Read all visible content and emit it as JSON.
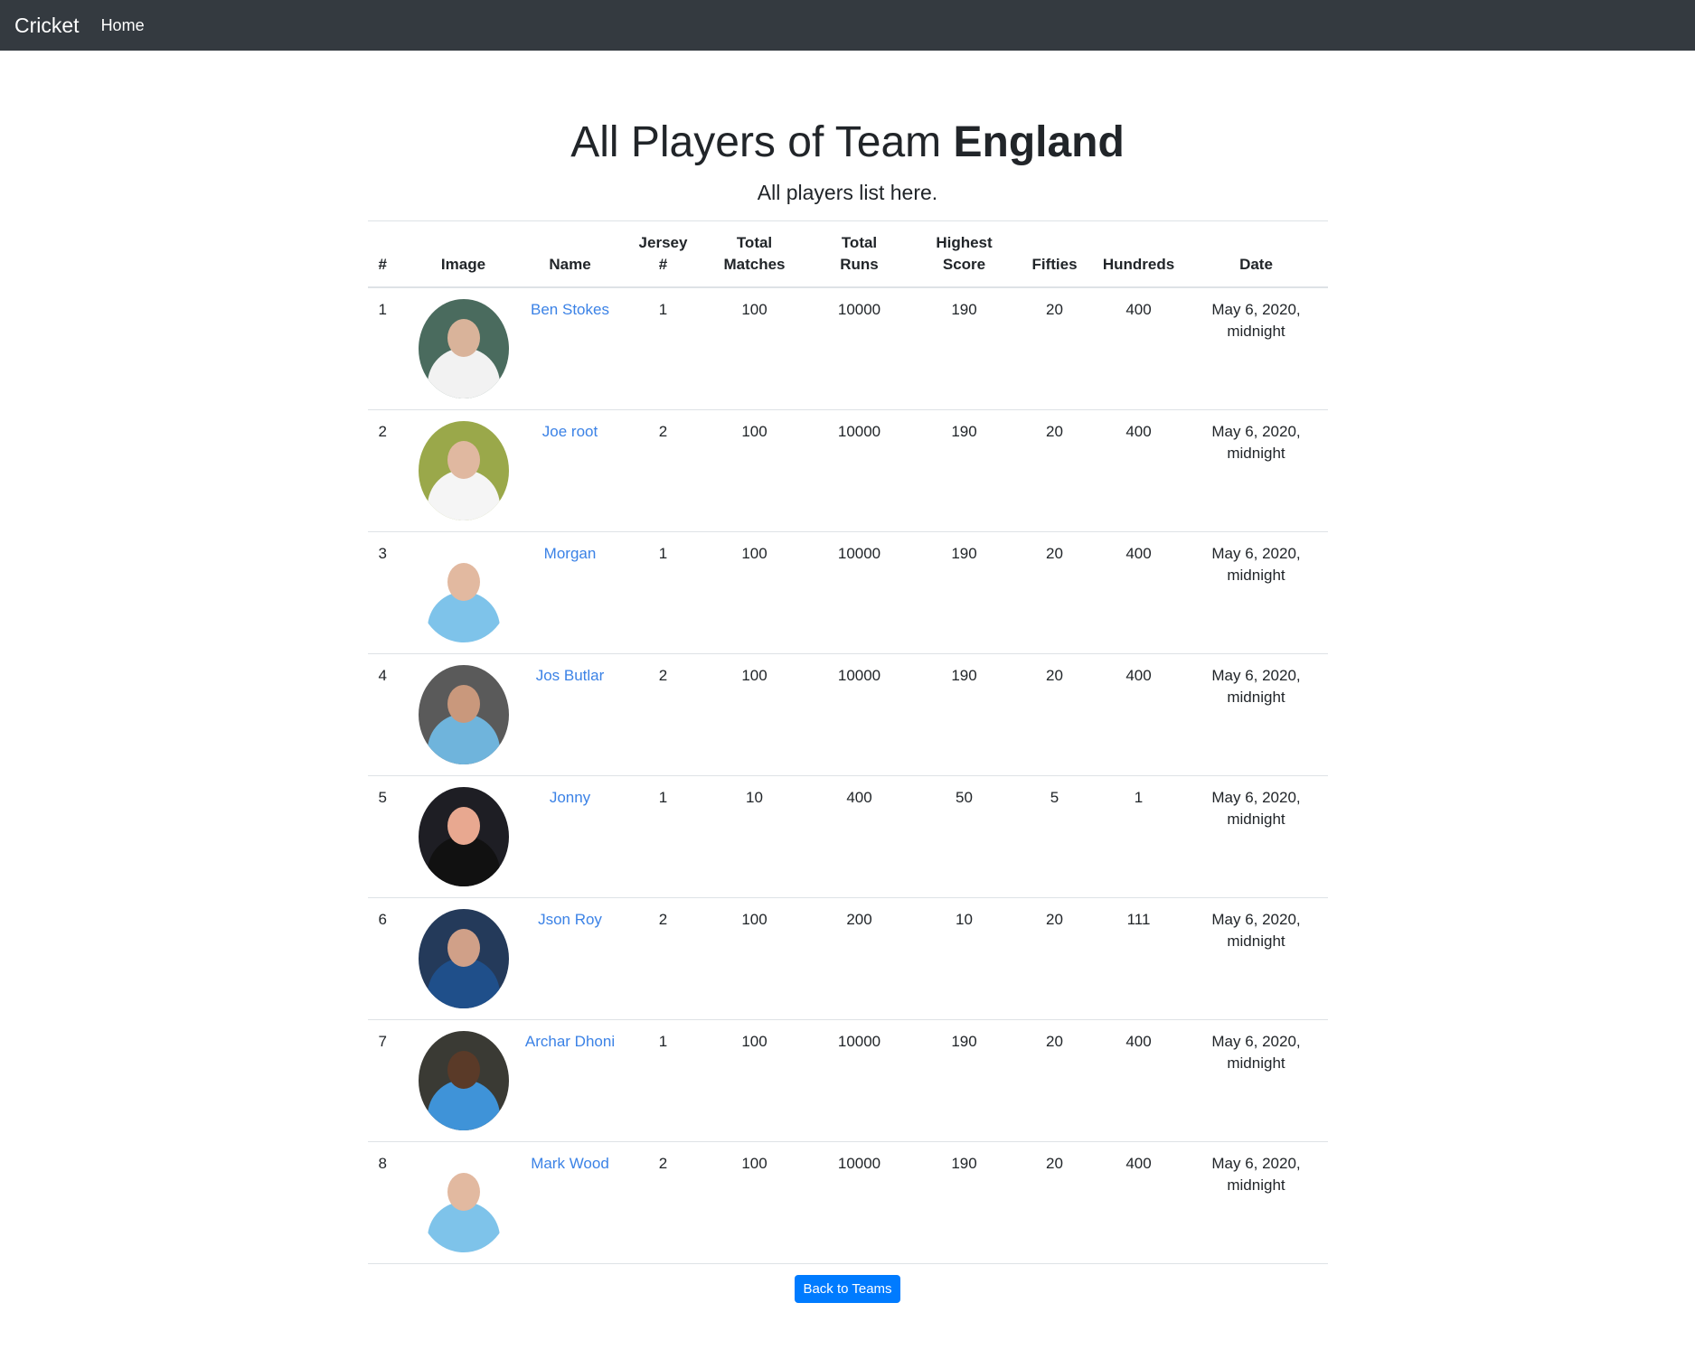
{
  "navbar": {
    "brand": "Cricket",
    "home": "Home"
  },
  "page": {
    "title_prefix": "All Players of Team",
    "team": "England",
    "subtitle": "All players list here."
  },
  "table": {
    "headers": {
      "idx": "#",
      "image": "Image",
      "name": "Name",
      "jersey_1": "Jersey",
      "jersey_2": "#",
      "matches_1": "Total",
      "matches_2": "Matches",
      "runs_1": "Total",
      "runs_2": "Runs",
      "highest_1": "Highest",
      "highest_2": "Score",
      "fifties": "Fifties",
      "hundreds": "Hundreds",
      "date": "Date"
    },
    "rows": [
      {
        "idx": "1",
        "name": "Ben Stokes",
        "jersey": "1",
        "matches": "100",
        "runs": "10000",
        "highest": "190",
        "fifties": "20",
        "hundreds": "400",
        "date_1": "May 6, 2020,",
        "date_2": "midnight",
        "bg": "#4a6b5e",
        "skin": "#d9b39a",
        "shirt": "#f2f2f2"
      },
      {
        "idx": "2",
        "name": "Joe root",
        "jersey": "2",
        "matches": "100",
        "runs": "10000",
        "highest": "190",
        "fifties": "20",
        "hundreds": "400",
        "date_1": "May 6, 2020,",
        "date_2": "midnight",
        "bg": "#9aa84a",
        "skin": "#e0b8a0",
        "shirt": "#f5f5f5"
      },
      {
        "idx": "3",
        "name": "Morgan",
        "jersey": "1",
        "matches": "100",
        "runs": "10000",
        "highest": "190",
        "fifties": "20",
        "hundreds": "400",
        "date_1": "May 6, 2020,",
        "date_2": "midnight",
        "bg": "#ffffff",
        "skin": "#e2b9a0",
        "shirt": "#7ec3ea"
      },
      {
        "idx": "4",
        "name": "Jos Butlar",
        "jersey": "2",
        "matches": "100",
        "runs": "10000",
        "highest": "190",
        "fifties": "20",
        "hundreds": "400",
        "date_1": "May 6, 2020,",
        "date_2": "midnight",
        "bg": "#5a5a5a",
        "skin": "#c9987c",
        "shirt": "#6fb4dc"
      },
      {
        "idx": "5",
        "name": "Jonny",
        "jersey": "1",
        "matches": "10",
        "runs": "400",
        "highest": "50",
        "fifties": "5",
        "hundreds": "1",
        "date_1": "May 6, 2020,",
        "date_2": "midnight",
        "bg": "#1e1e24",
        "skin": "#e8a890",
        "shirt": "#111111"
      },
      {
        "idx": "6",
        "name": "Json Roy",
        "jersey": "2",
        "matches": "100",
        "runs": "200",
        "highest": "10",
        "fifties": "20",
        "hundreds": "111",
        "date_1": "May 6, 2020,",
        "date_2": "midnight",
        "bg": "#243a5a",
        "skin": "#d0a088",
        "shirt": "#1f4f8a"
      },
      {
        "idx": "7",
        "name": "Archar Dhoni",
        "jersey": "1",
        "matches": "100",
        "runs": "10000",
        "highest": "190",
        "fifties": "20",
        "hundreds": "400",
        "date_1": "May 6, 2020,",
        "date_2": "midnight",
        "bg": "#3a3a34",
        "skin": "#5a3a28",
        "shirt": "#3f93d8"
      },
      {
        "idx": "8",
        "name": "Mark Wood",
        "jersey": "2",
        "matches": "100",
        "runs": "10000",
        "highest": "190",
        "fifties": "20",
        "hundreds": "400",
        "date_1": "May 6, 2020,",
        "date_2": "midnight",
        "bg": "#ffffff",
        "skin": "#e2b9a0",
        "shirt": "#7ec3ea"
      }
    ]
  },
  "footer": {
    "back_button": "Back to Teams"
  },
  "colors": {
    "navbar": "#343a40",
    "link": "#3b82e6",
    "button": "#007bff"
  }
}
